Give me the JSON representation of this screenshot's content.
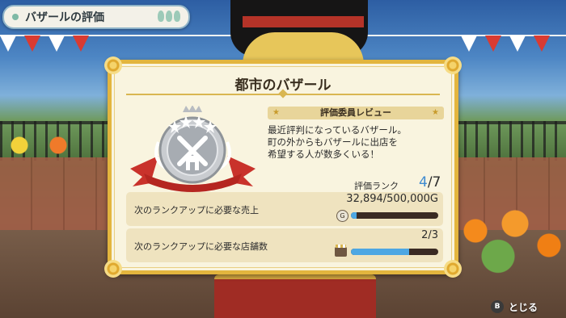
{
  "header": {
    "title": "バザールの評価"
  },
  "panel": {
    "title": "都市のバザール",
    "review": {
      "heading": "評価委員レビュー",
      "lines": [
        "最近評判になっているバザール。",
        "町の外からもバザールに出店を",
        "希望する人が数多くいる！"
      ]
    },
    "rank": {
      "label": "評価ランク",
      "current": "4",
      "max": "/7"
    },
    "requirements": [
      {
        "label": "次のランクアップに必要な売上",
        "value": "32,894/500,000G",
        "icon": "gold-coin-icon",
        "progress": 0.066
      },
      {
        "label": "次のランクアップに必要な店舗数",
        "value": "2/3",
        "icon": "shop-stall-icon",
        "progress": 0.667
      }
    ]
  },
  "footer": {
    "close_key": "B",
    "close_label": "とじる"
  },
  "colors": {
    "frame": "#e3b53e",
    "panel_bg": "#f9f4df",
    "progress_fill": "#4da7e3",
    "rank_highlight": "#3f8bd0"
  }
}
